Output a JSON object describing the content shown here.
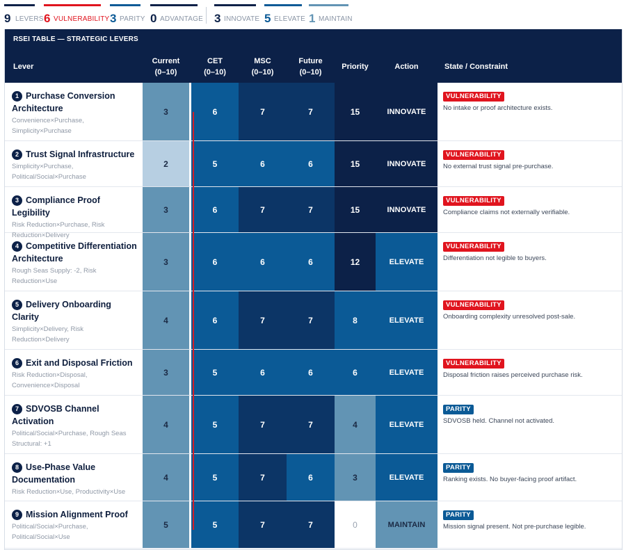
{
  "colors": {
    "navy": "#0c2148",
    "vulnerability": "#e0141e",
    "parity": "#0b5a96",
    "advantage": "#0c2148",
    "innovate": "#0c2148",
    "elevate": "#0b5a96",
    "maintain": "#6294b4"
  },
  "stats": [
    {
      "num": "9",
      "label": "LEVERS",
      "bar_color": "#0c2148",
      "num_color": "#0c2148"
    },
    {
      "num": "6",
      "label": "VULNERABILITY",
      "bar_color": "#e0141e",
      "num_color": "#e0141e"
    },
    {
      "num": "3",
      "label": "PARITY",
      "bar_color": "#0b5a96",
      "num_color": "#0b5a96"
    },
    {
      "num": "0",
      "label": "ADVANTAGE",
      "bar_color": "#0c2148",
      "num_color": "#0c2148"
    },
    {
      "num": "3",
      "label": "INNOVATE",
      "bar_color": "#0c2148",
      "num_color": "#0c2148"
    },
    {
      "num": "5",
      "label": "ELEVATE",
      "bar_color": "#0b5a96",
      "num_color": "#0b5a96"
    },
    {
      "num": "1",
      "label": "MAINTAIN",
      "bar_color": "#6294b4",
      "num_color": "#6294b4"
    }
  ],
  "table": {
    "caption": "RSEI TABLE — STRATEGIC LEVERS",
    "headers": {
      "lever": "Lever",
      "current": "Current",
      "current_sub": "(0–10)",
      "cet": "CET",
      "cet_sub": "(0–10)",
      "msc": "MSC",
      "msc_sub": "(0–10)",
      "future": "Future",
      "future_sub": "(0–10)",
      "priority": "Priority",
      "action": "Action",
      "state": "State / Constraint"
    },
    "rows": [
      {
        "n": "1",
        "title": "Purchase Conversion Architecture",
        "sub": "Convenience×Purchase, Simplicity×Purchase",
        "current": "3",
        "cet": "6",
        "msc": "7",
        "future": "7",
        "priority": "15",
        "action": "INNOVATE",
        "state": "VULNERABILITY",
        "note": "No intake or proof architecture exists."
      },
      {
        "n": "2",
        "title": "Trust Signal Infrastructure",
        "sub": "Simplicity×Purchase, Political/Social×Purchase",
        "current": "2",
        "cet": "5",
        "msc": "6",
        "future": "6",
        "priority": "15",
        "action": "INNOVATE",
        "state": "VULNERABILITY",
        "note": "No external trust signal pre-purchase."
      },
      {
        "n": "3",
        "title": "Compliance Proof Legibility",
        "sub": "Risk Reduction×Purchase, Risk Reduction×Delivery",
        "current": "3",
        "cet": "6",
        "msc": "7",
        "future": "7",
        "priority": "15",
        "action": "INNOVATE",
        "state": "VULNERABILITY",
        "note": "Compliance claims not externally verifiable."
      },
      {
        "n": "4",
        "title": "Competitive Differentiation Architecture",
        "sub": "Rough Seas Supply: -2, Risk Reduction×Use",
        "current": "3",
        "cet": "6",
        "msc": "6",
        "future": "6",
        "priority": "12",
        "action": "ELEVATE",
        "state": "VULNERABILITY",
        "note": "Differentiation not legible to buyers."
      },
      {
        "n": "5",
        "title": "Delivery Onboarding Clarity",
        "sub": "Simplicity×Delivery, Risk Reduction×Delivery",
        "current": "4",
        "cet": "6",
        "msc": "7",
        "future": "7",
        "priority": "8",
        "action": "ELEVATE",
        "state": "VULNERABILITY",
        "note": "Onboarding complexity unresolved post-sale."
      },
      {
        "n": "6",
        "title": "Exit and Disposal Friction",
        "sub": "Risk Reduction×Disposal, Convenience×Disposal",
        "current": "3",
        "cet": "5",
        "msc": "6",
        "future": "6",
        "priority": "6",
        "action": "ELEVATE",
        "state": "VULNERABILITY",
        "note": "Disposal friction raises perceived purchase risk."
      },
      {
        "n": "7",
        "title": "SDVOSB Channel Activation",
        "sub": "Political/Social×Purchase, Rough Seas Structural: +1",
        "current": "4",
        "cet": "5",
        "msc": "7",
        "future": "7",
        "priority": "4",
        "action": "ELEVATE",
        "state": "PARITY",
        "note": "SDVOSB held. Channel not activated."
      },
      {
        "n": "8",
        "title": "Use-Phase Value Documentation",
        "sub": "Risk Reduction×Use, Productivity×Use",
        "current": "4",
        "cet": "5",
        "msc": "7",
        "future": "6",
        "priority": "3",
        "action": "ELEVATE",
        "state": "PARITY",
        "note": "Ranking exists. No buyer-facing proof artifact."
      },
      {
        "n": "9",
        "title": "Mission Alignment Proof",
        "sub": "Political/Social×Purchase, Political/Social×Use",
        "current": "5",
        "cet": "5",
        "msc": "7",
        "future": "7",
        "priority": "0",
        "action": "MAINTAIN",
        "state": "PARITY",
        "note": "Mission signal present. Not pre-purchase legible."
      }
    ]
  }
}
